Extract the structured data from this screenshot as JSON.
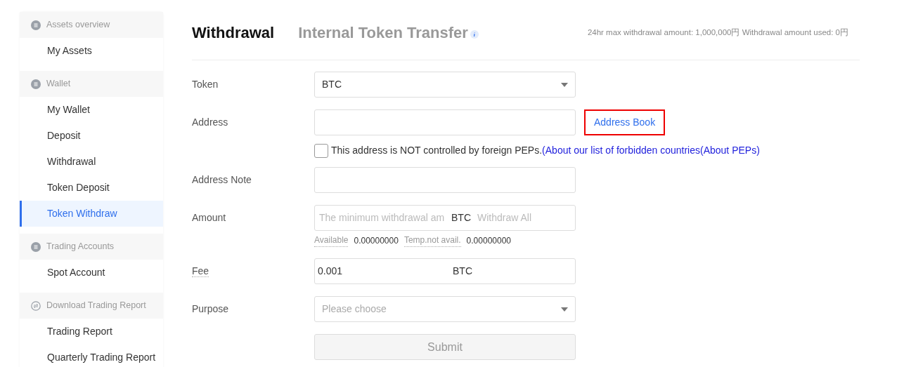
{
  "sidebar": {
    "groups": [
      {
        "kind": "category",
        "title": "Assets overview",
        "items": [
          {
            "label": "My Assets",
            "selected": false
          }
        ]
      },
      {
        "kind": "category",
        "title": "Wallet",
        "items": [
          {
            "label": "My Wallet",
            "selected": false
          },
          {
            "label": "Deposit",
            "selected": false
          },
          {
            "label": "Withdrawal",
            "selected": false
          },
          {
            "label": "Token Deposit",
            "selected": false
          },
          {
            "label": "Token Withdraw",
            "selected": true
          }
        ]
      },
      {
        "kind": "category",
        "title": "Trading Accounts",
        "items": [
          {
            "label": "Spot Account",
            "selected": false
          }
        ]
      },
      {
        "kind": "download",
        "title": "Download Trading Report",
        "items": [
          {
            "label": "Trading Report",
            "selected": false
          },
          {
            "label": "Quarterly Trading Report",
            "selected": false
          }
        ]
      }
    ]
  },
  "tabs": [
    {
      "label": "Withdrawal",
      "selected": true,
      "info": false
    },
    {
      "label": "Internal Token Transfer",
      "selected": false,
      "info": true
    }
  ],
  "limits": "24hr max withdrawal amount: 1,000,000円  Withdrawal amount used: 0円",
  "form": {
    "rows": [
      {
        "kind": "select",
        "label": "Token",
        "value": "BTC"
      },
      {
        "kind": "input",
        "label": "Address",
        "link": "Address Book",
        "link_highlighted": true
      },
      {
        "kind": "checkbox",
        "checked": false,
        "text": "This address is NOT controlled by foreign PEPs.",
        "link": "(About our list of forbidden countries(About PEPs)"
      },
      {
        "kind": "input",
        "label": "Address Note"
      },
      {
        "kind": "amount",
        "label": "Amount",
        "placeholder": "The minimum withdrawal am",
        "unit": "BTC",
        "action": "Withdraw All",
        "available_label": "Available",
        "available": "0.00000000",
        "temp_label": "Temp.not avail.",
        "temp": "0.00000000"
      },
      {
        "kind": "fee",
        "label": "Fee",
        "value": "0.001",
        "unit": "BTC"
      },
      {
        "kind": "select",
        "label": "Purpose",
        "placeholder": "Please choose"
      },
      {
        "kind": "submit",
        "label": "Submit",
        "disabled": true
      }
    ]
  }
}
